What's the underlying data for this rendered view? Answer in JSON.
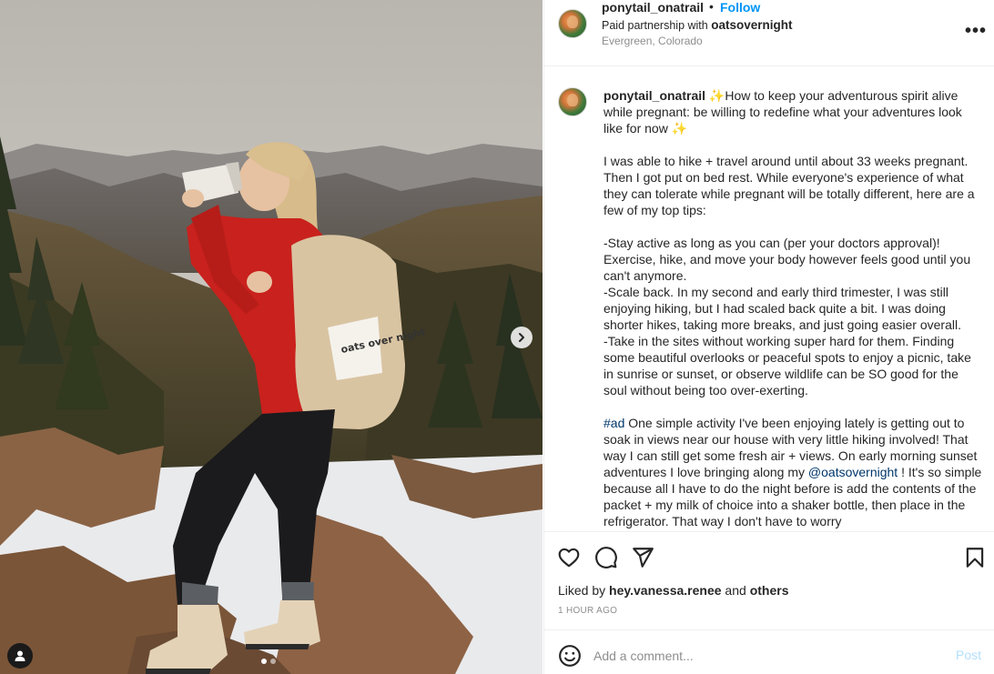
{
  "photo": {
    "carousel_index": 1,
    "carousel_total": 2,
    "product_label": "oats over night"
  },
  "header": {
    "username": "ponytail_onatrail",
    "separator": "•",
    "follow_label": "Follow",
    "partnership_prefix": "Paid partnership with ",
    "partner": "oatsovernight",
    "location": "Evergreen, Colorado",
    "more_label": "•••"
  },
  "caption": {
    "username": "ponytail_onatrail",
    "intro_sparkle": "✨",
    "intro": "How to keep your adventurous spirit alive while pregnant: be willing to redefine what your adventures look like for now ",
    "intro_sparkle_end": "✨",
    "para1": "I was able to hike + travel around until about 33 weeks pregnant. Then I got put on bed rest. While everyone's experience of what they can tolerate while pregnant will be totally different, here are a few of my top tips:",
    "tip1": "-Stay active as long as you can (per your doctors approval)! Exercise, hike, and move your body however feels good until you can't anymore.",
    "tip2": "-Scale back. In my second and early third trimester, I was still enjoying hiking, but I had scaled back quite a bit. I was doing shorter hikes, taking more breaks, and just going easier overall.",
    "tip3": "-Take in the sites without working super hard for them. Finding some beautiful overlooks or peaceful spots to enjoy a picnic, take in sunrise or sunset, or observe wildlife can be SO good for the soul without being too over-exerting.",
    "hashtag": "#ad",
    "para2_a": " One simple activity I've been enjoying lately is getting out to soak in views near our house with very little hiking involved! That way I can still get some fresh air + views. On early morning sunset adventures I love bringing along my ",
    "mention": "@oatsovernight",
    "para2_b": " ! It's so simple because all I have to do the night before is add the contents of the packet + my milk of choice into a shaker bottle, then place in the refrigerator. That way I don't have to worry"
  },
  "actions": {
    "like_icon": "heart-icon",
    "comment_icon": "comment-icon",
    "share_icon": "paper-plane-icon",
    "save_icon": "bookmark-icon"
  },
  "likes": {
    "prefix": "Liked by ",
    "user": "hey.vanessa.renee",
    "middle": " and ",
    "others": "others"
  },
  "timestamp": "1 HOUR AGO",
  "comment": {
    "placeholder": "Add a comment...",
    "post_label": "Post"
  },
  "colors": {
    "accent": "#0095f6",
    "post_disabled": "#b2dffc",
    "link": "#00376b",
    "muted": "#8e8e8e"
  }
}
